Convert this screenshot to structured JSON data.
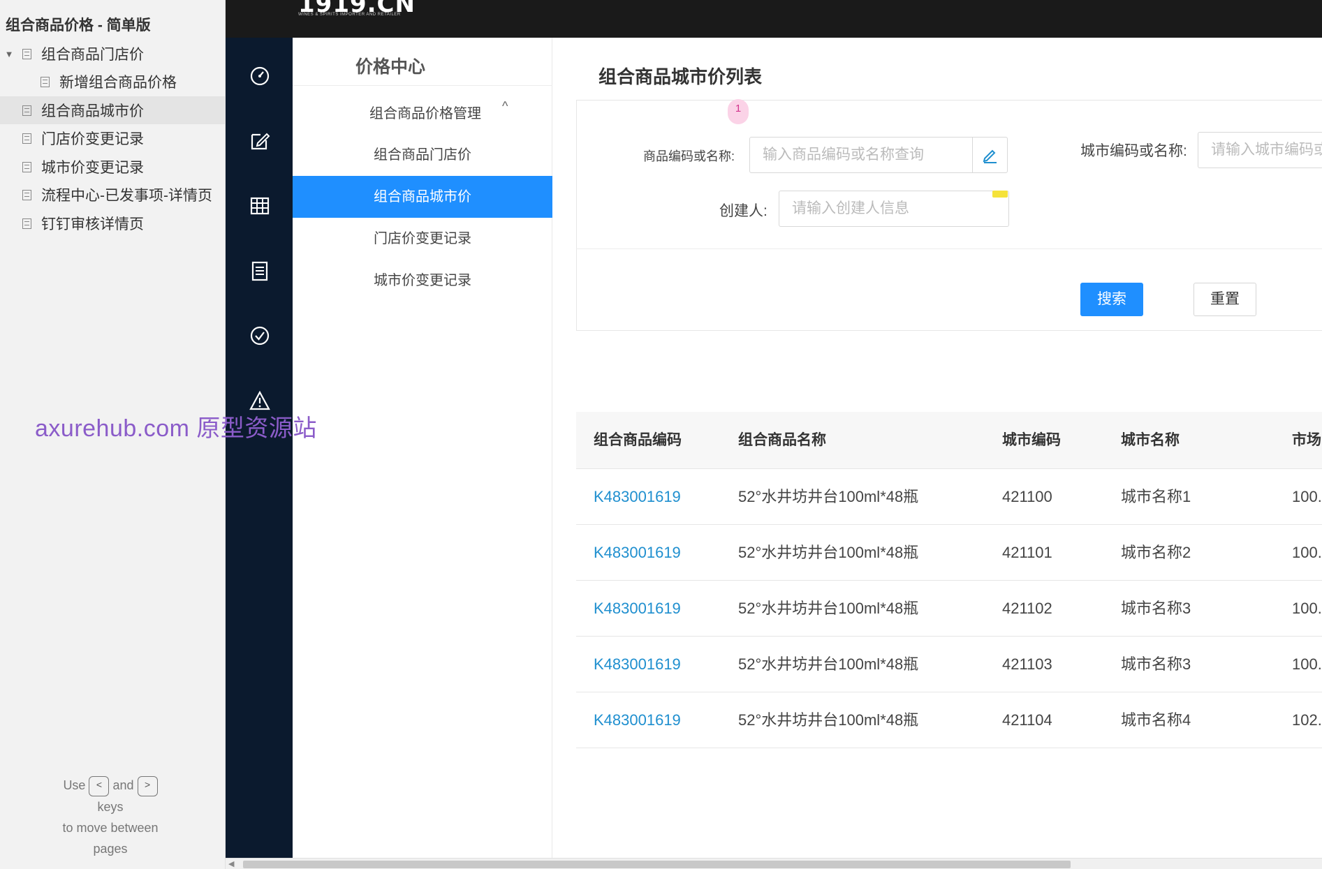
{
  "sitemap": {
    "title": "组合商品价格 - 简单版",
    "items": [
      {
        "label": "组合商品门店价",
        "expanded": true
      },
      {
        "label": "新增组合商品价格"
      },
      {
        "label": "组合商品城市价",
        "selected": true
      },
      {
        "label": "门店价变更记录"
      },
      {
        "label": "城市价变更记录"
      },
      {
        "label": "流程中心-已发事项-详情页"
      },
      {
        "label": "钉钉审核详情页"
      }
    ],
    "hint": {
      "use": "Use",
      "prev_key": "<",
      "and": "and",
      "next_key": ">",
      "keys": "keys",
      "line3": "to move between",
      "line4": "pages"
    }
  },
  "topbar": {
    "logo": "1919.CN",
    "logo_tagline": "WINES & SPIRITS IMPORTER AND RETAILER"
  },
  "iconbar": {
    "icons": [
      "dashboard-icon",
      "edit-icon",
      "grid-icon",
      "list-icon",
      "check-circle-icon",
      "warning-icon"
    ]
  },
  "menu": {
    "title": "价格中心",
    "group": "组合商品价格管理",
    "group_caret": "^",
    "items": [
      {
        "label": "组合商品门店价"
      },
      {
        "label": "组合商品城市价",
        "active": true
      },
      {
        "label": "门店价变更记录"
      },
      {
        "label": "城市价变更记录"
      }
    ]
  },
  "main": {
    "title": "组合商品城市价列表",
    "badge": "1",
    "filters": {
      "product": {
        "label": "商品编码或名称:",
        "placeholder": "输入商品编码或名称查询"
      },
      "city": {
        "label": "城市编码或名称:",
        "placeholder": "请输入城市编码或名称"
      },
      "creator": {
        "label": "创建人:",
        "placeholder": "请输入创建人信息"
      }
    },
    "buttons": {
      "search": "搜索",
      "reset": "重置"
    }
  },
  "table": {
    "columns": [
      "组合商品编码",
      "组合商品名称",
      "城市编码",
      "城市名称",
      "市场"
    ],
    "rows": [
      {
        "code": "K483001619",
        "name": "52°水井坊井台100ml*48瓶",
        "city_code": "421100",
        "city_name": "城市名称1",
        "market": "100."
      },
      {
        "code": "K483001619",
        "name": "52°水井坊井台100ml*48瓶",
        "city_code": "421101",
        "city_name": "城市名称2",
        "market": "100."
      },
      {
        "code": "K483001619",
        "name": "52°水井坊井台100ml*48瓶",
        "city_code": "421102",
        "city_name": "城市名称3",
        "market": "100."
      },
      {
        "code": "K483001619",
        "name": "52°水井坊井台100ml*48瓶",
        "city_code": "421103",
        "city_name": "城市名称3",
        "market": "100."
      },
      {
        "code": "K483001619",
        "name": "52°水井坊井台100ml*48瓶",
        "city_code": "421104",
        "city_name": "城市名称4",
        "market": "102."
      }
    ]
  },
  "watermark": "axurehub.com 原型资源站",
  "colors": {
    "primary": "#1f8fff",
    "link": "#1f8fcf",
    "sidebar": "#0b1a2e",
    "topbar": "#1a1a1a",
    "watermark": "#8b5cc9"
  }
}
